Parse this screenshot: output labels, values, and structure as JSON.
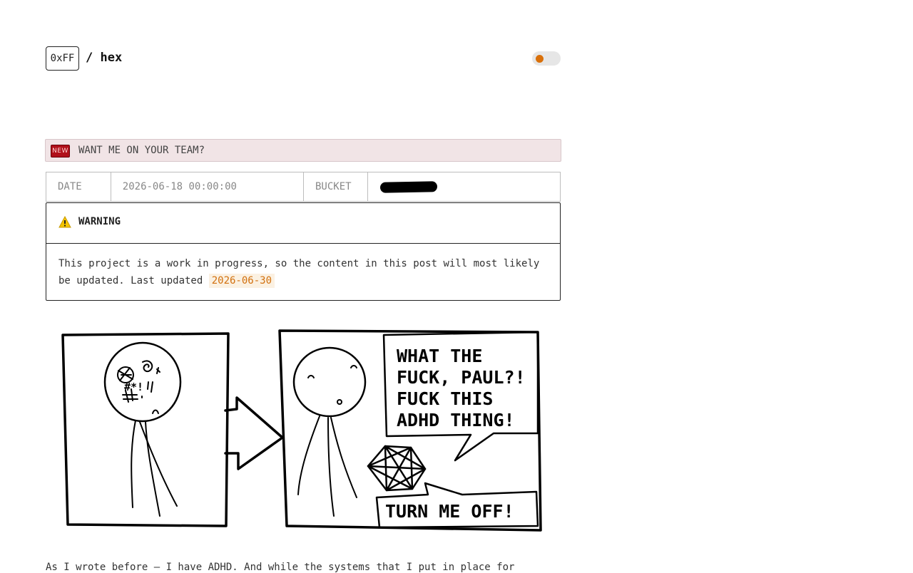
{
  "header": {
    "logo": "0xFF",
    "title": "/ hex",
    "accent": "#d9700a"
  },
  "banner": {
    "badge": "NEW",
    "text": "WANT ME ON YOUR TEAM?"
  },
  "meta": {
    "date_label": "DATE",
    "date_value": "2026-06-18 00:00:00",
    "bucket_label": "BUCKET"
  },
  "warning": {
    "title": "WARNING",
    "body": "This project is a work in progress, so the content in this post will most likely be updated. Last updated ",
    "last_updated": "2026-06-30"
  },
  "comic": {
    "bubble_line1": "WHAT THE",
    "bubble_line2": "FUCK, PAUL?!",
    "bubble_line3": "FUCK THIS",
    "bubble_line4": "ADHD THING!",
    "scribble": "#*!",
    "caption": "TURN ME OFF!"
  },
  "article": {
    "paragraph": "As I wrote before — I have ADHD. And while the systems that I put in place for"
  }
}
